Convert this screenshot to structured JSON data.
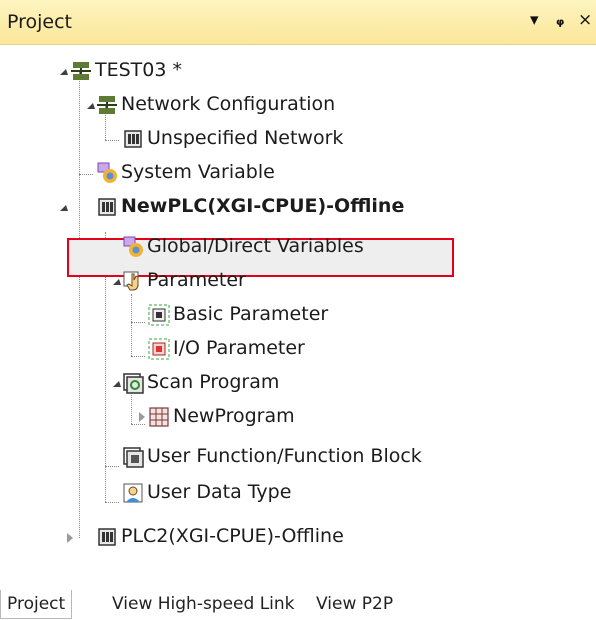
{
  "panel": {
    "title": "Project",
    "controls": {
      "dropdown": "▾",
      "pin": "ᵩ",
      "close": "×"
    }
  },
  "tree": {
    "root": "TEST03 *",
    "network_configuration": "Network Configuration",
    "unspecified_network": "Unspecified Network",
    "system_variable": "System Variable",
    "plc1": "NewPLC(XGI-CPUE)-Offline",
    "global_direct_variables": "Global/Direct Variables",
    "parameter": "Parameter",
    "basic_parameter": "Basic Parameter",
    "io_parameter": "I/O Parameter",
    "scan_program": "Scan Program",
    "new_program": "NewProgram",
    "user_function_block": "User Function/Function Block",
    "user_data_type": "User Data Type",
    "plc2": "PLC2(XGI-CPUE)-Offline"
  },
  "tabs": {
    "project": "Project",
    "view_high_speed_link": "View High-speed Link",
    "view_p2p": "View P2P"
  },
  "icons": {
    "project": "project-network-icon",
    "network": "network-config-icon",
    "plc": "plc-module-icon",
    "system_variable": "system-variable-icon",
    "global_variables": "global-variables-icon",
    "parameter": "parameter-hand-icon",
    "basic_parameter": "basic-parameter-icon",
    "io_parameter": "io-parameter-icon",
    "scan_program": "scan-program-icon",
    "program": "program-icon",
    "function_block": "function-block-icon",
    "user_data_type": "user-data-type-icon"
  },
  "colors": {
    "titlebar": "#fbe79a",
    "highlight_border": "#e3001b"
  }
}
